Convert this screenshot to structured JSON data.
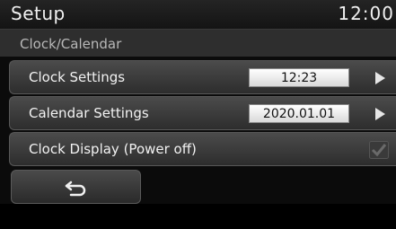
{
  "header": {
    "title": "Setup",
    "time": "12:00"
  },
  "section": {
    "title": "Clock/Calendar"
  },
  "rows": [
    {
      "label": "Clock Settings",
      "value": "12:23"
    },
    {
      "label": "Calendar Settings",
      "value": "2020.01.01"
    },
    {
      "label": "Clock Display (Power off)",
      "checked": true
    }
  ],
  "icons": {
    "back": "back-arrow-icon",
    "arrow": "chevron-right-icon",
    "check": "checkmark-icon"
  }
}
